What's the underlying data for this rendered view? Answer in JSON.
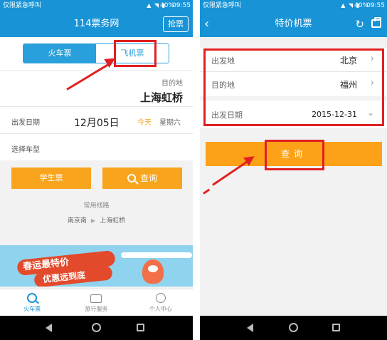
{
  "left": {
    "statusbar": {
      "carrier": "仅限紧急呼叫",
      "battery": "40%",
      "time": "09:55"
    },
    "appbar": {
      "title": "114票务网",
      "grab_label": "抢票"
    },
    "segment": {
      "train_label": "火车票",
      "flight_label": "飞机票"
    },
    "form": {
      "departure_placeholder": "",
      "destination_label": "目的地",
      "destination_value": "上海虹桥",
      "date_label": "出发日期",
      "date_value": "12月05日",
      "today_label": "今天",
      "weekday_label": "星期六",
      "seat_type_label": "选择车型"
    },
    "buttons": {
      "student_label": "学生票",
      "query_label": "查询"
    },
    "common_routes": {
      "title": "常用线路",
      "from": "南京南",
      "to": "上海虹桥"
    },
    "banner": {
      "line1": "春运最特价",
      "line2": "优惠远到底"
    },
    "bottom_nav": [
      {
        "label": "火车票",
        "icon": "search-icon",
        "active": true
      },
      {
        "label": "旅行服务",
        "icon": "briefcase-icon",
        "active": false
      },
      {
        "label": "个人中心",
        "icon": "person-icon",
        "active": false
      }
    ]
  },
  "right": {
    "statusbar": {
      "carrier": "仅限紧急呼叫",
      "battery": "40%",
      "time": "09:55"
    },
    "appbar": {
      "title": "特价机票"
    },
    "form": {
      "departure_label": "出发地",
      "departure_value": "北京",
      "destination_label": "目的地",
      "destination_value": "福州",
      "date_label": "出发日期",
      "date_value": "2015-12-31"
    },
    "query_label": "查询"
  },
  "colors": {
    "primary": "#1793d6",
    "accent_orange": "#f8a41c",
    "annotation_red": "#e02020"
  }
}
